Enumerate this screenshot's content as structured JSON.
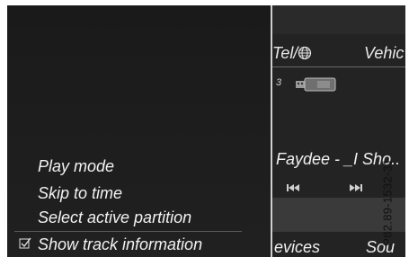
{
  "menu": {
    "items": [
      {
        "label": "Play mode"
      },
      {
        "label": "Skip to time"
      },
      {
        "label": "Select active partition"
      },
      {
        "label": "Show track information",
        "checked": true
      }
    ]
  },
  "background_screen": {
    "top_tabs": [
      "Tel/",
      "Vehic"
    ],
    "source_index": "3",
    "track_title": "Faydee - _I Sho..",
    "bottom_tabs": [
      "evices",
      "Sou"
    ]
  },
  "figure_reference": "P82.89-1532-31"
}
